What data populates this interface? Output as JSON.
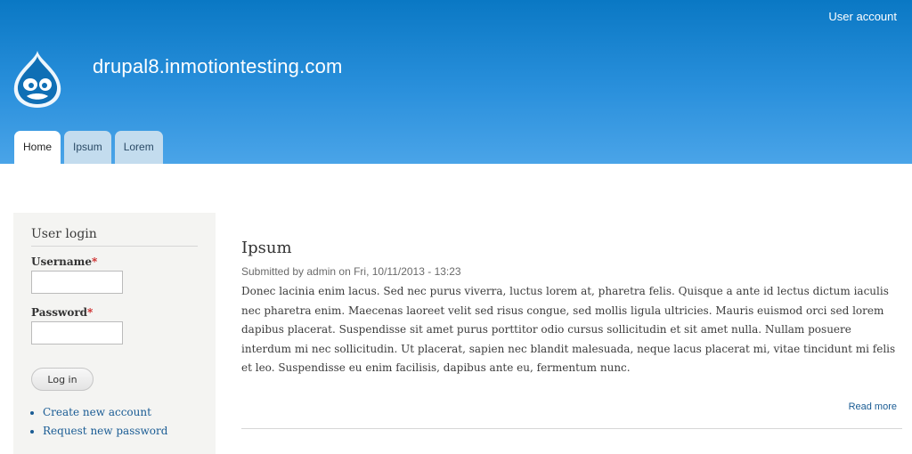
{
  "header": {
    "user_account_label": "User account",
    "site_name": "drupal8.inmotiontesting.com",
    "logo_icon": "drupal-drop-icon",
    "colors": {
      "gradient_top": "#0a78c4",
      "gradient_bottom": "#4aa4e8"
    }
  },
  "tabs": [
    {
      "label": "Home",
      "active": true
    },
    {
      "label": "Ipsum",
      "active": false
    },
    {
      "label": "Lorem",
      "active": false
    }
  ],
  "sidebar": {
    "block_title": "User login",
    "username_label": "Username",
    "password_label": "Password",
    "required_marker": "*",
    "username_value": "",
    "password_value": "",
    "login_button": "Log in",
    "links": [
      "Create new account",
      "Request new password"
    ]
  },
  "article": {
    "title": "Ipsum",
    "submitted": "Submitted by admin on Fri, 10/11/2013 - 13:23",
    "body": "Donec lacinia enim lacus. Sed nec purus viverra, luctus lorem at, pharetra felis. Quisque a ante id lectus dictum iaculis nec pharetra enim. Maecenas laoreet velit sed risus congue, sed mollis ligula ultricies. Mauris euismod orci sed lorem dapibus placerat. Suspendisse sit amet purus porttitor odio cursus sollicitudin et sit amet nulla. Nullam posuere interdum mi nec sollicitudin. Ut placerat, sapien nec blandit malesuada, neque lacus placerat mi, vitae tincidunt mi felis et leo. Suspendisse eu enim facilisis, dapibus ante eu, fermentum nunc.",
    "read_more": "Read more"
  }
}
